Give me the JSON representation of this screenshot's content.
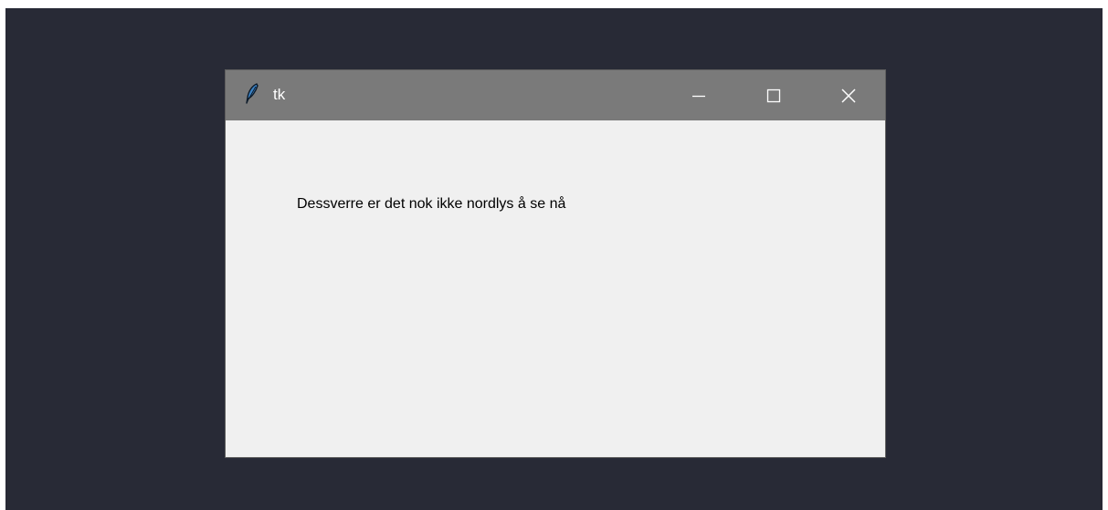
{
  "window": {
    "title": "tk",
    "icon": "feather-icon"
  },
  "titlebar_buttons": {
    "minimize": "minimize-icon",
    "maximize": "maximize-icon",
    "close": "close-icon"
  },
  "content": {
    "message": "Dessverre er det nok ikke nordlys å se nå"
  },
  "colors": {
    "desktop": "#282a36",
    "titlebar": "#7a7a7a",
    "window_body": "#f0f0f0",
    "title_text": "#ffffff",
    "message_text": "#000000"
  }
}
